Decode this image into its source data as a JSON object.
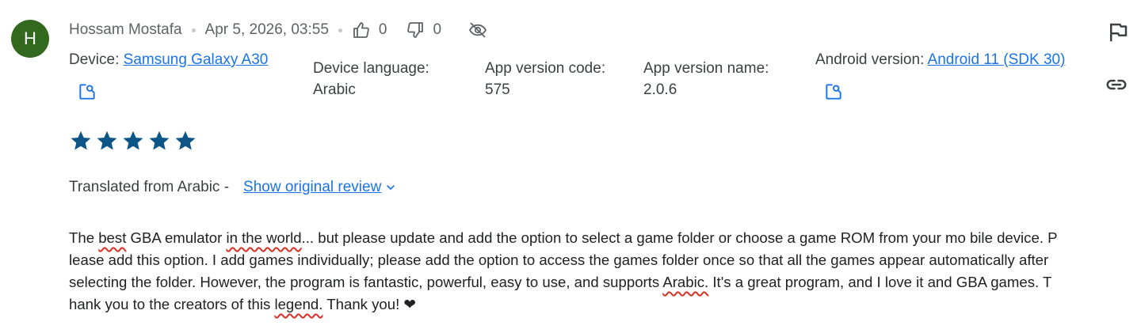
{
  "author": {
    "initial": "H",
    "name": "Hossam Mostafa",
    "avatar_color": "#33691e"
  },
  "meta": {
    "date": "Apr 5, 2026, 03:55",
    "thumbs_up_count": "0",
    "thumbs_down_count": "0"
  },
  "device_info": {
    "device_label": "Device:",
    "device_value": "Samsung Galaxy A30",
    "language_label": "Device language:",
    "language_value": "Arabic",
    "version_code_label": "App version code:",
    "version_code_value": "575",
    "version_name_label": "App version name:",
    "version_name_value": "2.0.6",
    "android_label": "Android version:",
    "android_value": "Android 11 (SDK 30)"
  },
  "rating": {
    "stars": 5,
    "max": 5,
    "color": "#0b5587"
  },
  "translation": {
    "label": "Translated from Arabic -",
    "toggle": "Show original review"
  },
  "review": {
    "segments": [
      {
        "text": "The ",
        "hl": false
      },
      {
        "text": "best",
        "hl": true
      },
      {
        "text": " GBA emulator ",
        "hl": false
      },
      {
        "text": "in the world",
        "hl": true
      },
      {
        "text": "... but please update and add the option to select a game folder or choose a game ROM from your mo bile device. Please add this option. I add games individually; please add the option to access the games folder once so that all the games appear automatically after selecting the folder. However, the program is fantastic, powerful, easy to use, and supports ",
        "hl": false
      },
      {
        "text": "Arabic.",
        "hl": true
      },
      {
        "text": " It's a great program, and I love it and GBA games. Thank you to the creators of this ",
        "hl": false
      },
      {
        "text": "legend.",
        "hl": true
      },
      {
        "text": " Thank you! ❤",
        "hl": false
      }
    ]
  },
  "colors": {
    "link": "#1a73e8",
    "spell_underline": "#d93025"
  }
}
